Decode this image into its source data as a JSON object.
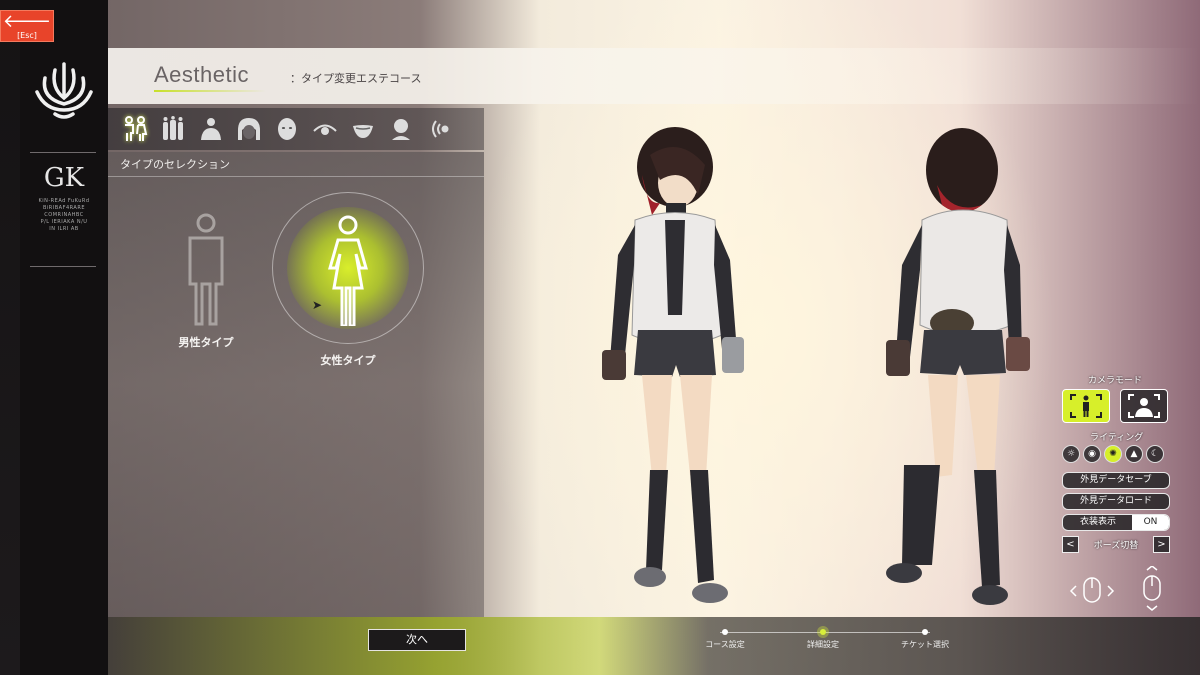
{
  "window": {
    "esc_label": "[Esc]"
  },
  "sidebar": {
    "logo2_mark": "GK",
    "logo2_fine_lines": [
      "KiN-REAd FuKuRd",
      "BiRIBAF4RARE",
      "COMRINAHBC",
      "P/L IERIAKA N/U",
      "IN ILRI AB"
    ]
  },
  "header": {
    "title": "Aesthetic",
    "subtitle": "：タイプ変更エステコース"
  },
  "tabs": [
    {
      "icon": "gender-pair-icon",
      "active": true
    },
    {
      "icon": "body-type-icon",
      "active": false
    },
    {
      "icon": "torso-icon",
      "active": false
    },
    {
      "icon": "hair-icon",
      "active": false
    },
    {
      "icon": "face-icon",
      "active": false
    },
    {
      "icon": "eye-icon",
      "active": false
    },
    {
      "icon": "mouth-icon",
      "active": false
    },
    {
      "icon": "accessory-icon",
      "active": false
    },
    {
      "icon": "voice-icon",
      "active": false
    }
  ],
  "panel": {
    "section_title": "タイプのセレクション",
    "options": [
      {
        "label": "男性タイプ",
        "selected": false
      },
      {
        "label": "女性タイプ",
        "selected": true
      }
    ]
  },
  "bottom": {
    "next_label": "次へ",
    "steps": [
      {
        "label": "コース設定",
        "active": false
      },
      {
        "label": "詳細設定",
        "active": true
      },
      {
        "label": "チケット選択",
        "active": false
      }
    ]
  },
  "controls": {
    "camera_mode_label": "カメラモード",
    "lighting_label": "ライティング",
    "save_label": "外見データセーブ",
    "load_label": "外見データロード",
    "costume_label": "衣装表示",
    "costume_value": "ON",
    "pose_label": "ポーズ切替",
    "pose_prev": "<",
    "pose_next": ">"
  },
  "colors": {
    "accent": "#d7ef2a",
    "esc": "#e8442a"
  }
}
